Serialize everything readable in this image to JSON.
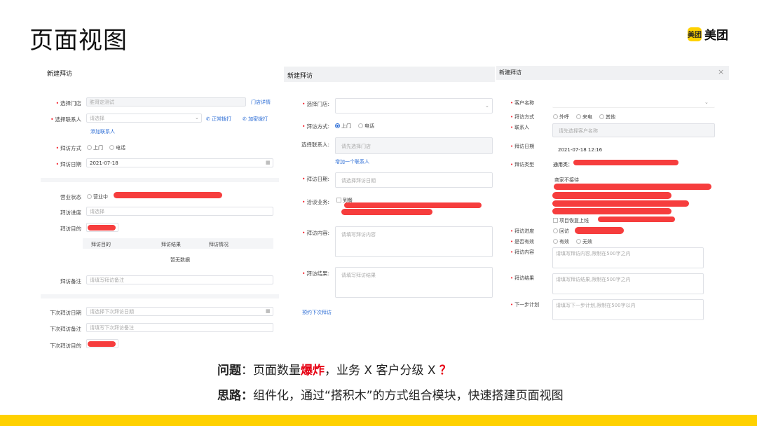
{
  "slide": {
    "title": "页面视图",
    "logo_mark": "美团",
    "logo_text": "美团"
  },
  "panel1": {
    "title": "新建拜访",
    "store_label": "选择门店",
    "store_value": "胜哥定测试",
    "store_link": "门店详情",
    "contact_label": "选择联系人",
    "contact_placeholder": "请选择",
    "call_normal": "正常拨打",
    "call_encrypted": "加密拨打",
    "add_contact": "添加联系人",
    "method_label": "拜访方式",
    "method_opt1": "上门",
    "method_opt2": "电话",
    "date_label": "拜访日期",
    "date_value": "2021-07-18",
    "biz_status_label": "营业状态",
    "biz_status_opt": "营业中",
    "progress_label": "拜访进度",
    "progress_placeholder": "请选择",
    "purpose_label": "拜访目的",
    "table_headers": [
      "拜访目的",
      "拜访结果",
      "拜访情况"
    ],
    "table_empty": "暂无数据",
    "remark_label": "拜访备注",
    "remark_placeholder": "请填写拜访备注",
    "next_date_label": "下次拜访日期",
    "next_date_placeholder": "请选择下次拜访日期",
    "next_remark_label": "下次拜访备注",
    "next_remark_placeholder": "请填写下次拜访备注",
    "next_purpose_label": "下次拜访目的"
  },
  "panel2": {
    "title": "新建拜访",
    "store_label": "选择门店:",
    "method_label": "拜访方式:",
    "method_opt1": "上门",
    "method_opt2": "电话",
    "contact_label": "选择联系人:",
    "contact_placeholder": "请先选择门店",
    "add_contact": "增加一个联系人",
    "date_label": "拜访日期:",
    "date_placeholder": "请选择拜访日期",
    "biz_label": "洽谈业务:",
    "biz_opt": "到餐",
    "content_label": "拜访内容:",
    "content_placeholder": "请填写拜访内容",
    "result_label": "拜访结果:",
    "result_placeholder": "请填写拜访结果",
    "schedule_link": "预约下次拜访"
  },
  "panel3": {
    "title": "新建拜访",
    "customer_label": "客户名称",
    "method_label": "拜访方式",
    "method_opts": [
      "外呼",
      "来电",
      "其他"
    ],
    "contact_label": "联系人",
    "contact_placeholder": "请先选择客户名称",
    "date_label": "拜访日期",
    "date_value": "2021-07-18 12:16",
    "type_label": "拜访类型",
    "type_general": "通用类：",
    "type_opt1": "商家不接待",
    "type_opt2": "项目恢复上线",
    "progress_label": "拜访进度",
    "progress_opt": "回访",
    "valid_label": "是否有效",
    "valid_opt1": "有效",
    "valid_opt2": "无效",
    "content_label": "拜访内容",
    "content_placeholder": "请填写拜访内容,限制在500字之内",
    "result_label": "拜访结果",
    "result_placeholder": "请填写拜访结果,限制在500字之内",
    "next_label": "下一步计划",
    "next_placeholder": "请填写下一步计划,限制在500字以内"
  },
  "bottom": {
    "problem_label": "问题",
    "problem_text1": "：页面数量",
    "problem_highlight": "爆炸",
    "problem_text2": "，业务  X  客户分级 X ",
    "problem_mark": "？",
    "idea_label": "思路：",
    "idea_text": "组件化，通过“搭积木”的方式组合模块，快速搭建页面视图"
  },
  "colors": {
    "brand_yellow": "#ffd100",
    "accent_blue": "#2f6fd6",
    "required_red": "#f5222d",
    "highlight_red": "#e60012"
  }
}
